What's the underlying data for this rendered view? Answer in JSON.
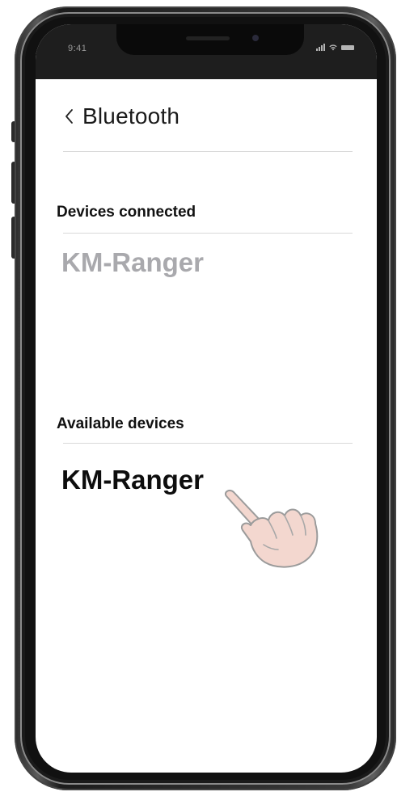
{
  "status_bar": {
    "time": "9:41"
  },
  "header": {
    "back_icon": "chevron-left-icon",
    "title": "Bluetooth"
  },
  "sections": {
    "connected": {
      "title": "Devices  connected",
      "devices": [
        "KM-Ranger"
      ]
    },
    "available": {
      "title": "Available devices",
      "devices": [
        "KM-Ranger"
      ]
    }
  },
  "pointer": {
    "icon": "tapping-hand-icon"
  },
  "colors": {
    "connected_device_text": "#a9a9ad",
    "available_device_text": "#0d0d0d",
    "status_bar_bg": "#1e1e1e"
  }
}
